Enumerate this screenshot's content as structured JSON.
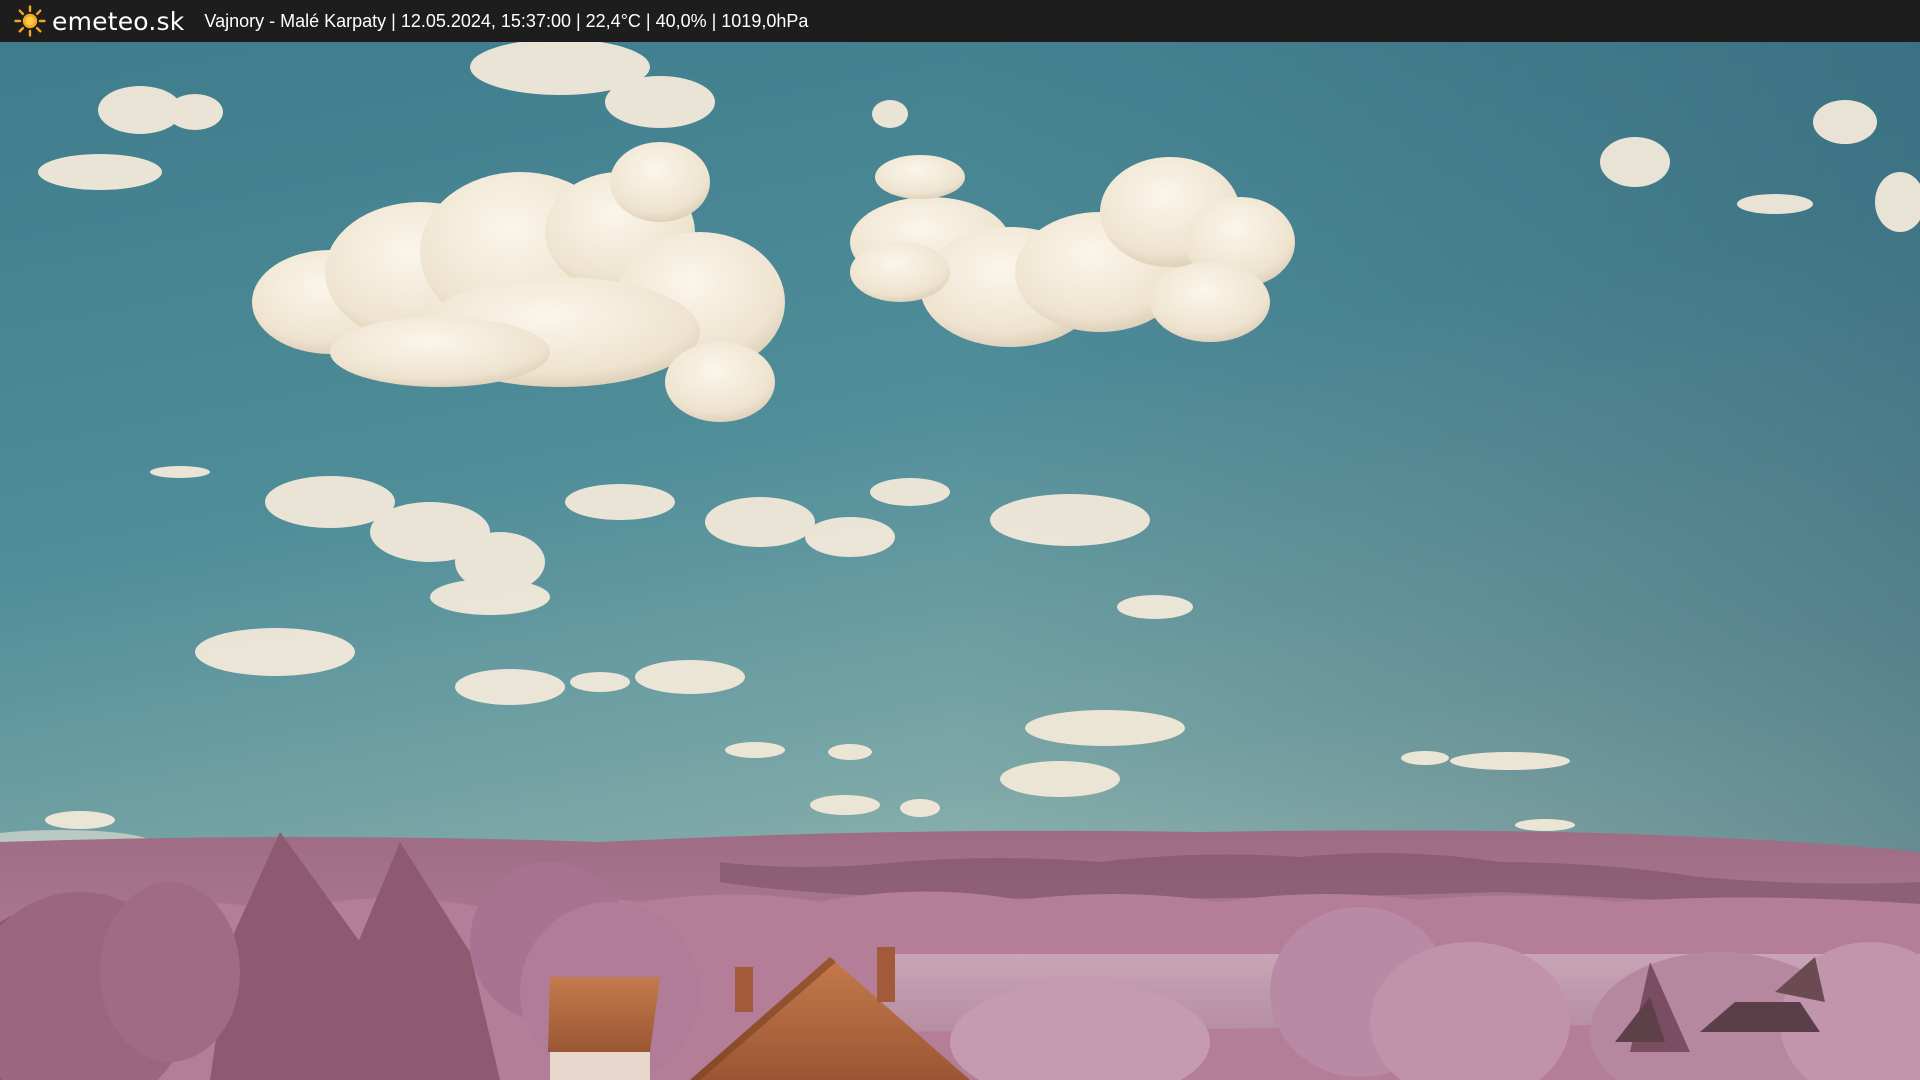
{
  "overlay": {
    "brand": "emeteo.sk",
    "brand_icon": "sun-icon",
    "station": "Vajnory - Malé Karpaty",
    "datetime": "12.05.2024, 15:37:00",
    "temperature": "22,4°C",
    "humidity": "40,0%",
    "pressure": "1019,0hPa",
    "info_line": "Vajnory - Malé Karpaty | 12.05.2024, 15:37:00 | 22,4°C | 40,0% | 1019,0hPa"
  },
  "colors": {
    "bar_background": "#1d1d1d",
    "bar_text": "#ffffff",
    "sun": "#f5a623",
    "sky_top": "#3a6e80",
    "sky_horizon": "#8fb4b0",
    "cloud": "#f2ebdc",
    "foliage": "#a86b86",
    "roof": "#b86a3e"
  }
}
